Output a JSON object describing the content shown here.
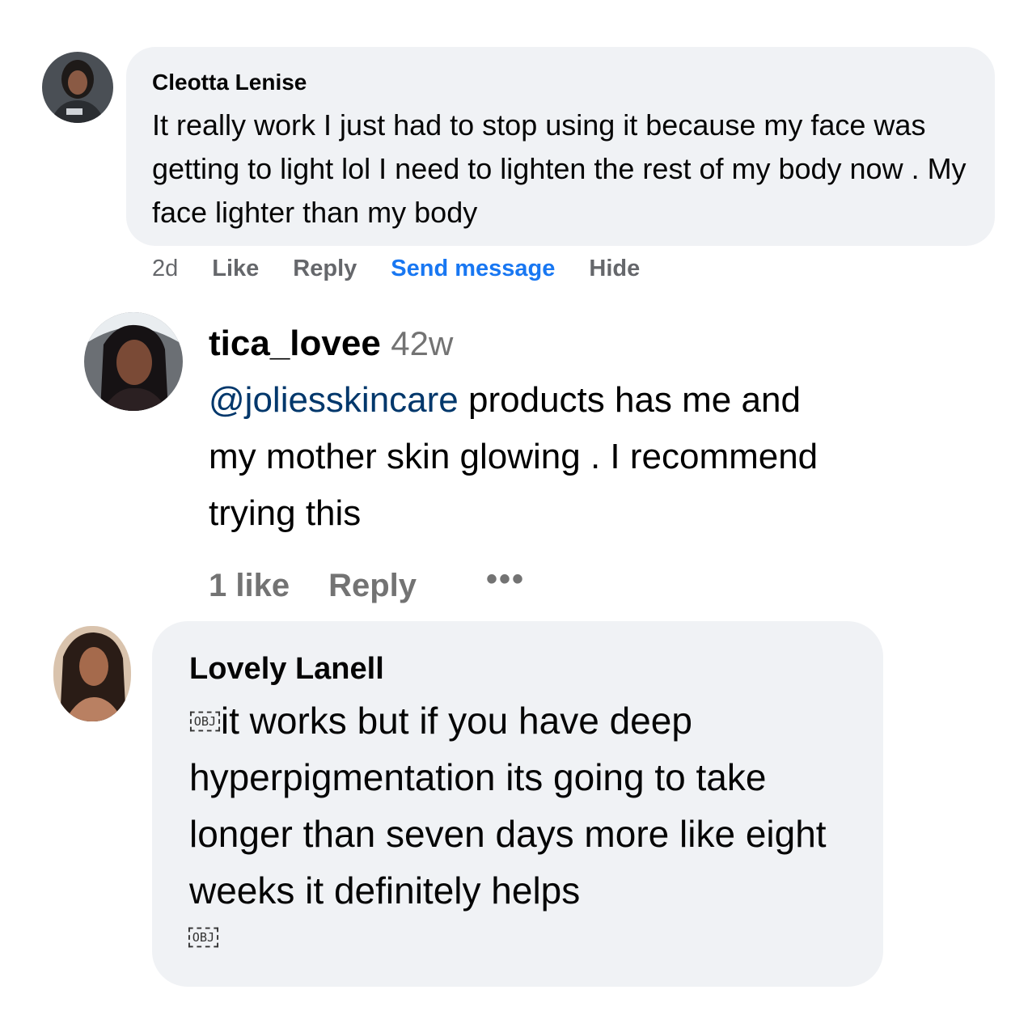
{
  "comment1": {
    "author": "Cleotta Lenise",
    "text": "It really work I just had to stop using it because my face was getting to light lol I need to lighten the rest of my body now . My face lighter than my body",
    "time": "2d",
    "actions": {
      "like": "Like",
      "reply": "Reply",
      "send_message": "Send message",
      "hide": "Hide"
    }
  },
  "comment2": {
    "author": "tica_lovee",
    "time": "42w",
    "mention": "@joliesskincare",
    "text": " products has me and my mother skin glowing . I recommend trying this",
    "likes": "1 like",
    "reply": "Reply",
    "more": "•••"
  },
  "comment3": {
    "author": "Lovely Lanell",
    "obj_placeholder": "OBJ",
    "text": "it works but if you have deep hyperpigmentation its going to take longer than seven days more like eight weeks it definitely helps",
    "obj_placeholder_end": "OBJ"
  },
  "colors": {
    "bubble": "#f0f2f5",
    "link_blue": "#1877f2",
    "mention_blue": "#00376b",
    "muted": "#65676b"
  }
}
